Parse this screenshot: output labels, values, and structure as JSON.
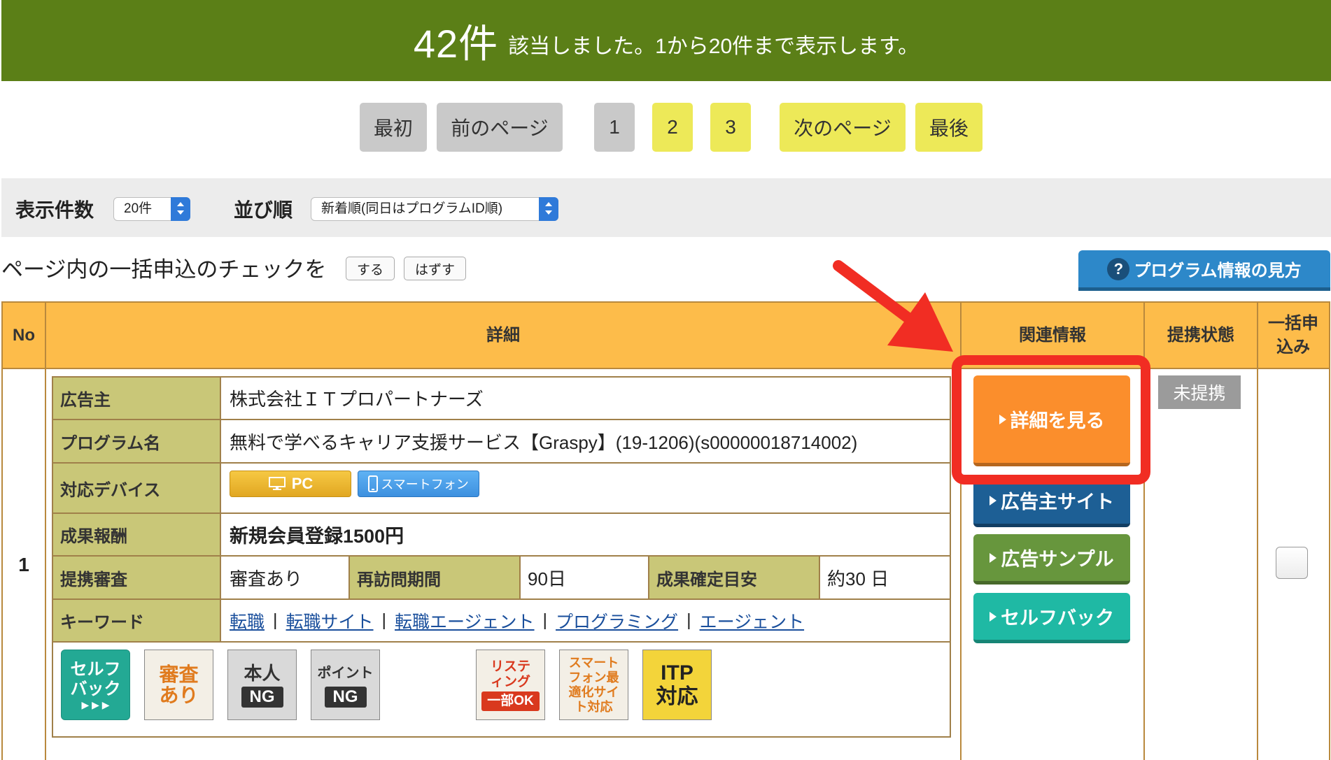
{
  "banner": {
    "count": "42件",
    "message": "該当しました。1から20件まで表示します。"
  },
  "pager": {
    "first": "最初",
    "prev": "前のページ",
    "pages": [
      "1",
      "2",
      "3"
    ],
    "next": "次のページ",
    "last": "最後"
  },
  "filter": {
    "per_page_label": "表示件数",
    "per_page_value": "20件",
    "sort_label": "並び順",
    "sort_value": "新着順(同日はプログラムID順)"
  },
  "bulk": {
    "label": "ページ内の一括申込のチェックを",
    "check_all": "する",
    "uncheck_all": "はずす"
  },
  "help_button": {
    "icon": "?",
    "label": "プログラム情報の見方"
  },
  "table": {
    "headers": {
      "no": "No",
      "detail": "詳細",
      "related": "関連情報",
      "status": "提携状態",
      "bulk": "一括申込み"
    }
  },
  "row": {
    "no": "1",
    "advertiser_label": "広告主",
    "advertiser": "株式会社ＩＴプロパートナーズ",
    "program_label": "プログラム名",
    "program": "無料で学べるキャリア支援サービス【Graspy】(19-1206)(s00000018714002)",
    "device_label": "対応デバイス",
    "device_pc": "PC",
    "device_sp": "スマートフォン",
    "reward_label": "成果報酬",
    "reward": "新規会員登録1500円",
    "review_label": "提携審査",
    "review": "審査あり",
    "revisit_label": "再訪問期間",
    "revisit": "90日",
    "confirm_label": "成果確定目安",
    "confirm": "約30 日",
    "keyword_label": "キーワード",
    "keywords": [
      "転職",
      "転職サイト",
      "転職エージェント",
      "プログラミング",
      "エージェント"
    ],
    "keyword_sep": "|",
    "badges": {
      "selfback": "セルフバック",
      "review": "審査あり",
      "self_ng_top": "本人",
      "self_ng_bottom": "NG",
      "point_ng_top": "ポイント",
      "point_ng_bottom": "NG",
      "listing_top": "リスティング",
      "listing_bottom": "一部OK",
      "smartphone": "スマートフォン最適化サイト対応",
      "itp": "ITP対応"
    },
    "buttons": {
      "details": "詳細を見る",
      "advertiser_site": "広告主サイト",
      "ad_sample": "広告サンプル",
      "selfback": "セルフバック"
    },
    "status": "未提携",
    "bulk_checked": false
  },
  "colors": {
    "banner": "#5b7f17",
    "header": "#fdbc4a",
    "label_cell": "#c9c778",
    "details_button": "#fb8e2c",
    "advertiser_button": "#1d5f95",
    "sample_button": "#67963d",
    "selfback_button": "#1fb9a4",
    "highlight": "#f12d23"
  }
}
